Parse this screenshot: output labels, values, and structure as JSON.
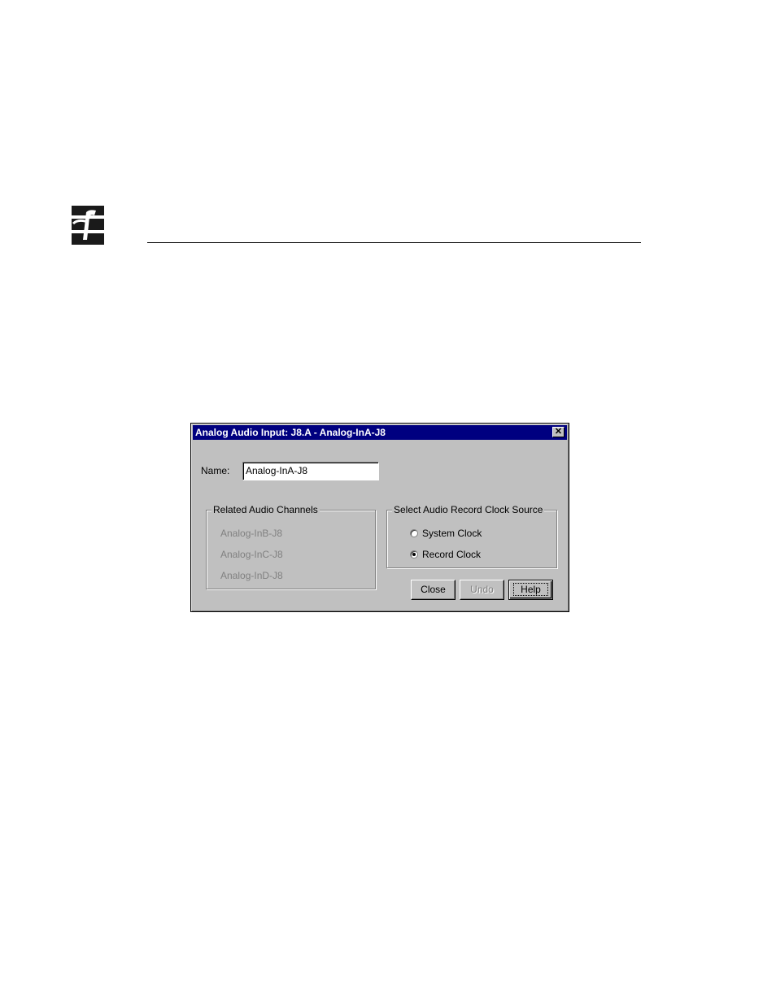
{
  "dialog": {
    "title": "Analog Audio Input: J8.A - Analog-InA-J8",
    "close_glyph": "✕",
    "name_label": "Name:",
    "name_value": "Analog-InA-J8",
    "related_group": {
      "title": "Related Audio Channels",
      "items": [
        "Analog-InB-J8",
        "Analog-InC-J8",
        "Analog-InD-J8"
      ]
    },
    "clock_group": {
      "title": "Select Audio Record Clock Source",
      "options": [
        {
          "label": "System Clock",
          "checked": false
        },
        {
          "label": "Record Clock",
          "checked": true
        }
      ]
    },
    "buttons": {
      "close": "Close",
      "undo": "Undo",
      "help": "Help"
    }
  }
}
